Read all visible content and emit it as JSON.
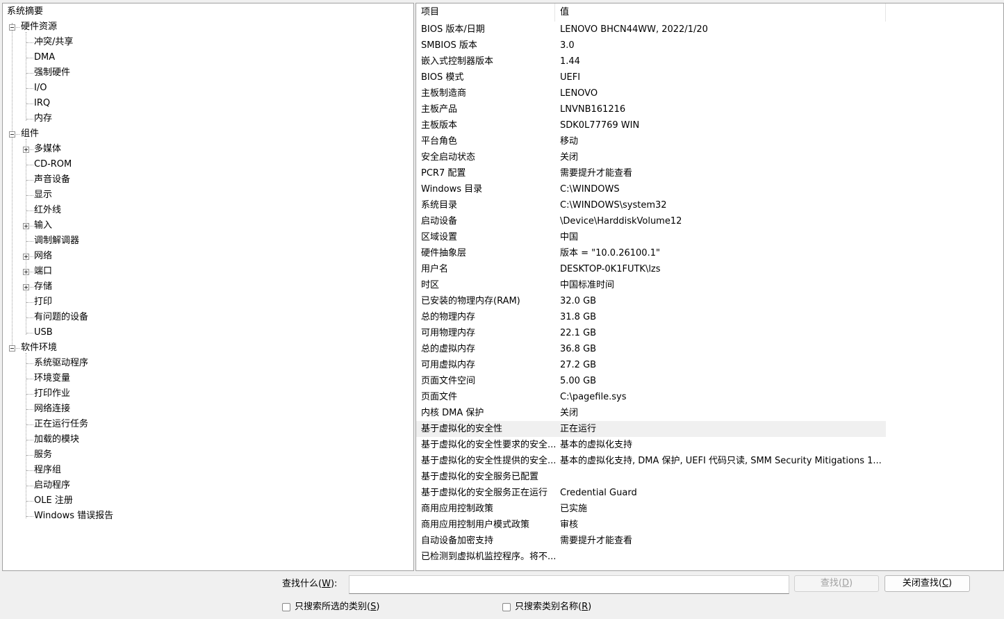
{
  "tree": {
    "root": "系统摘要",
    "hardware": {
      "label": "硬件资源",
      "toggle": "−",
      "children": [
        "冲突/共享",
        "DMA",
        "强制硬件",
        "I/O",
        "IRQ",
        "内存"
      ]
    },
    "components": {
      "label": "组件",
      "toggle": "−",
      "children": [
        {
          "label": "多媒体",
          "expandable": true
        },
        {
          "label": "CD-ROM",
          "expandable": false
        },
        {
          "label": "声音设备",
          "expandable": false
        },
        {
          "label": "显示",
          "expandable": false
        },
        {
          "label": "红外线",
          "expandable": false
        },
        {
          "label": "输入",
          "expandable": true
        },
        {
          "label": "调制解调器",
          "expandable": false
        },
        {
          "label": "网络",
          "expandable": true
        },
        {
          "label": "端口",
          "expandable": true
        },
        {
          "label": "存储",
          "expandable": true
        },
        {
          "label": "打印",
          "expandable": false
        },
        {
          "label": "有问题的设备",
          "expandable": false
        },
        {
          "label": "USB",
          "expandable": false
        }
      ]
    },
    "software": {
      "label": "软件环境",
      "toggle": "−",
      "children": [
        "系统驱动程序",
        "环境变量",
        "打印作业",
        "网络连接",
        "正在运行任务",
        "加载的模块",
        "服务",
        "程序组",
        "启动程序",
        "OLE 注册",
        "Windows 错误报告"
      ]
    }
  },
  "list": {
    "columns": {
      "item": "项目",
      "value": "值"
    },
    "rows": [
      {
        "name": "BIOS 版本/日期",
        "value": "LENOVO BHCN44WW, 2022/1/20"
      },
      {
        "name": "SMBIOS 版本",
        "value": "3.0"
      },
      {
        "name": "嵌入式控制器版本",
        "value": "1.44"
      },
      {
        "name": "BIOS 模式",
        "value": "UEFI"
      },
      {
        "name": "主板制造商",
        "value": "LENOVO"
      },
      {
        "name": "主板产品",
        "value": "LNVNB161216"
      },
      {
        "name": "主板版本",
        "value": "SDK0L77769 WIN"
      },
      {
        "name": "平台角色",
        "value": "移动"
      },
      {
        "name": "安全启动状态",
        "value": "关闭"
      },
      {
        "name": "PCR7 配置",
        "value": "需要提升才能查看"
      },
      {
        "name": "Windows 目录",
        "value": "C:\\WINDOWS"
      },
      {
        "name": "系统目录",
        "value": "C:\\WINDOWS\\system32"
      },
      {
        "name": "启动设备",
        "value": "\\Device\\HarddiskVolume12"
      },
      {
        "name": "区域设置",
        "value": "中国"
      },
      {
        "name": "硬件抽象层",
        "value": "版本 = \"10.0.26100.1\""
      },
      {
        "name": "用户名",
        "value": "DESKTOP-0K1FUTK\\lzs"
      },
      {
        "name": "时区",
        "value": "中国标准时间"
      },
      {
        "name": "已安装的物理内存(RAM)",
        "value": "32.0 GB"
      },
      {
        "name": "总的物理内存",
        "value": "31.8 GB"
      },
      {
        "name": "可用物理内存",
        "value": "22.1 GB"
      },
      {
        "name": "总的虚拟内存",
        "value": "36.8 GB"
      },
      {
        "name": "可用虚拟内存",
        "value": "27.2 GB"
      },
      {
        "name": "页面文件空间",
        "value": "5.00 GB"
      },
      {
        "name": "页面文件",
        "value": "C:\\pagefile.sys"
      },
      {
        "name": "内核 DMA 保护",
        "value": "关闭"
      },
      {
        "name": "基于虚拟化的安全性",
        "value": "正在运行",
        "highlight": true
      },
      {
        "name": "基于虚拟化的安全性要求的安全...",
        "value": "基本的虚拟化支持"
      },
      {
        "name": "基于虚拟化的安全性提供的安全...",
        "value": "基本的虚拟化支持, DMA 保护, UEFI 代码只读, SMM Security Mitigations 1...."
      },
      {
        "name": "基于虚拟化的安全服务已配置",
        "value": ""
      },
      {
        "name": "基于虚拟化的安全服务正在运行",
        "value": "Credential Guard"
      },
      {
        "name": "商用应用控制政策",
        "value": "已实施"
      },
      {
        "name": "商用应用控制用户模式政策",
        "value": "审核"
      },
      {
        "name": "自动设备加密支持",
        "value": "需要提升才能查看"
      },
      {
        "name": "已检测到虚拟机监控程序。将不...",
        "value": ""
      }
    ]
  },
  "find": {
    "label_text": "查找什么(",
    "label_key": "W",
    "label_end": "):",
    "input_value": "",
    "find_btn_text": "查找(",
    "find_btn_key": "D",
    "find_btn_end": ")",
    "close_btn_text": "关闭查找(",
    "close_btn_key": "C",
    "close_btn_end": ")",
    "check1_text": "只搜索所选的类别(",
    "check1_key": "S",
    "check1_end": ")",
    "check2_text": "只搜索类别名称(",
    "check2_key": "R",
    "check2_end": ")"
  },
  "colors": {
    "pane_bg": "#ffffff",
    "window_bg": "#f0f0f0",
    "highlight_row": "#f0f0f0",
    "disabled_text": "#a0a0a0"
  }
}
